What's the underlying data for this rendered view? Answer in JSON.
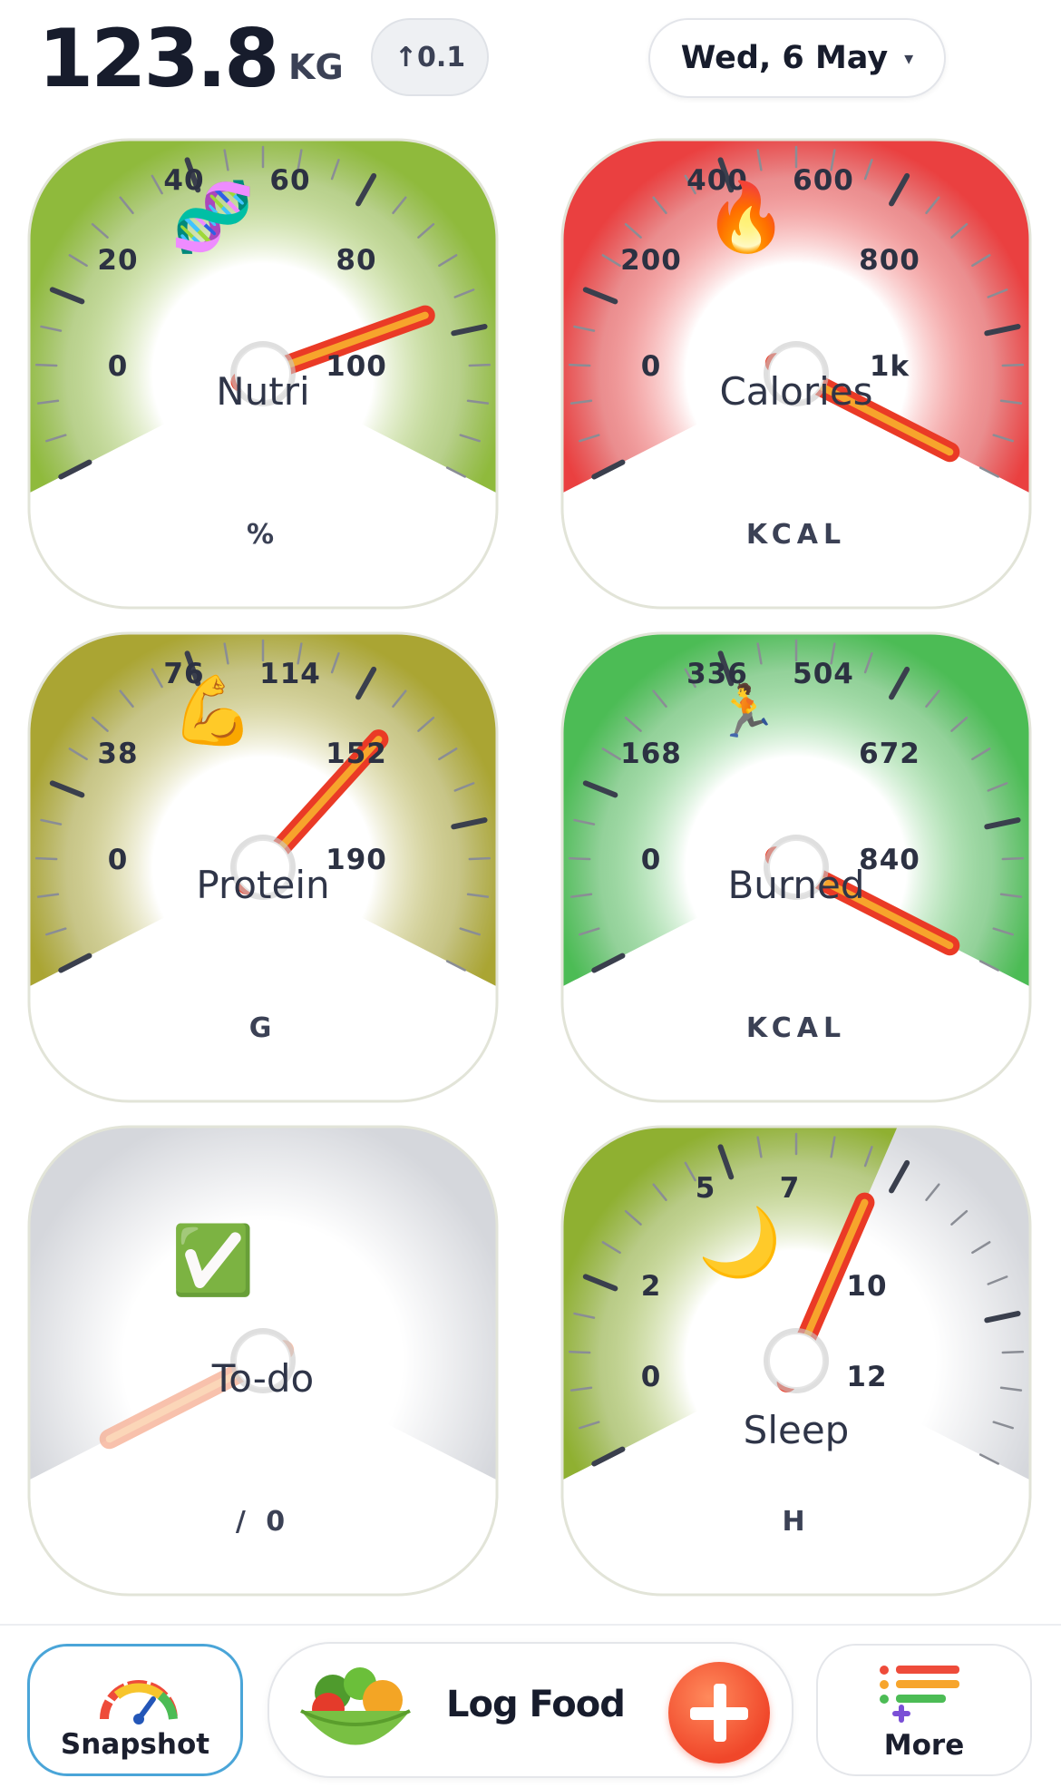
{
  "header": {
    "weight_value": "123.8",
    "weight_unit": "KG",
    "weight_delta": "↑0.1",
    "date": "Wed, 6 May",
    "date_caret": "▾"
  },
  "gauges": [
    {
      "id": "nutri",
      "label": "Nutri",
      "unit": "%",
      "icon": "🧬",
      "icon_name": "dna-icon",
      "ticks": [
        "0",
        "20",
        "40",
        "60",
        "80",
        "100"
      ],
      "value_fraction": 0.8,
      "color": "#8fba3c",
      "fill": "full"
    },
    {
      "id": "calories",
      "label": "Calories",
      "unit": "KCAL",
      "icon": "🔥",
      "icon_name": "fire-icon",
      "ticks": [
        "0",
        "200",
        "400",
        "600",
        "800",
        "1k"
      ],
      "value_fraction": 1.0,
      "color": "#ea4040",
      "fill": "full"
    },
    {
      "id": "protein",
      "label": "Protein",
      "unit": "G",
      "icon": "💪",
      "icon_name": "flexed-biceps-icon",
      "ticks": [
        "0",
        "38",
        "76",
        "114",
        "152",
        "190"
      ],
      "value_fraction": 0.68,
      "color": "#aaa533",
      "fill": "full"
    },
    {
      "id": "burned",
      "label": "Burned",
      "unit": "KCAL",
      "icon": "🏃",
      "icon_name": "runner-icon",
      "ticks": [
        "0",
        "168",
        "336",
        "504",
        "672",
        "840"
      ],
      "value_fraction": 1.0,
      "color": "#4cbc55",
      "fill": "full"
    },
    {
      "id": "todo",
      "label": "To-do",
      "unit": "/ 0",
      "icon": "✅",
      "icon_name": "check-mark-icon",
      "ticks": [],
      "value_fraction": 0.0,
      "color": "#cfd2d8",
      "fill": "none"
    },
    {
      "id": "sleep",
      "label": "Sleep",
      "unit": "H",
      "icon": "🌙",
      "icon_name": "moon-icon",
      "ticks": [
        "0",
        "2",
        "5",
        "7",
        "10",
        "12"
      ],
      "value_fraction": 0.6,
      "color": "#8fb031",
      "fill": "partial"
    }
  ],
  "bottom_bar": {
    "snapshot_label": "Snapshot",
    "log_food_label": "Log Food",
    "more_label": "More"
  }
}
